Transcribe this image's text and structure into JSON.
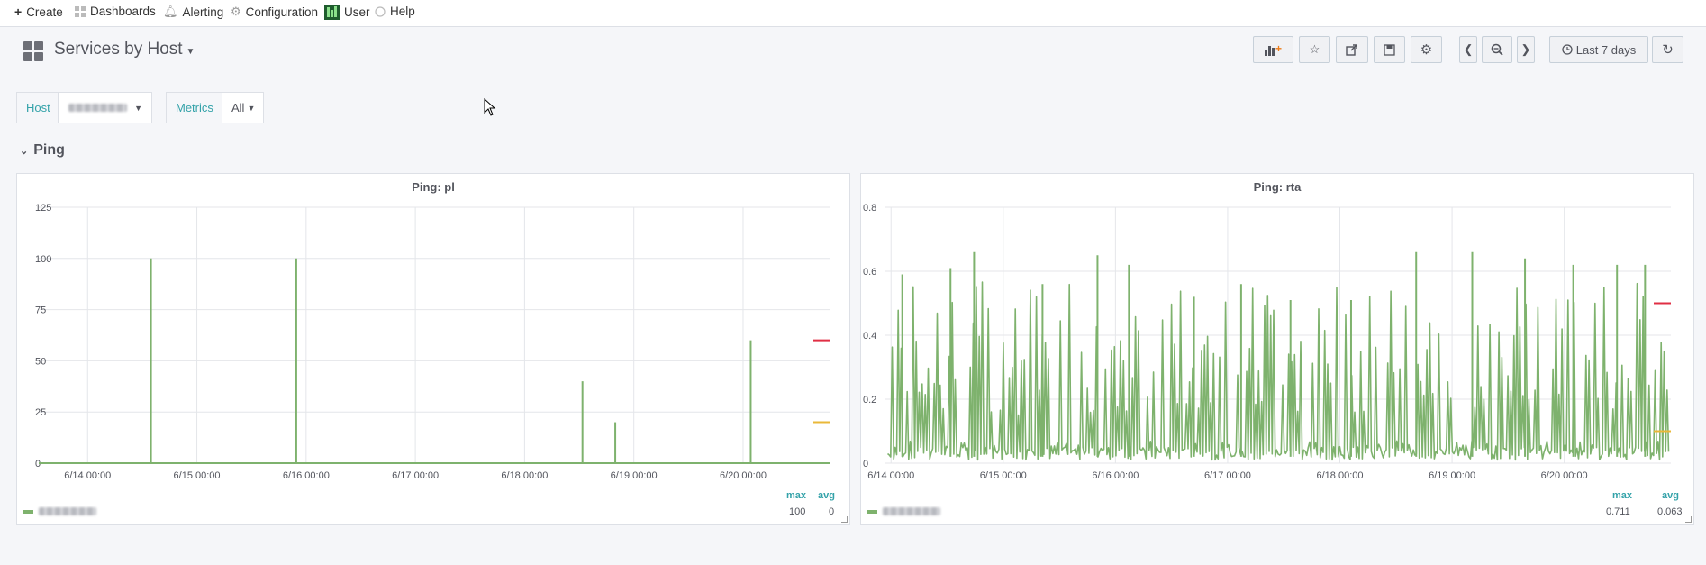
{
  "topnav": {
    "create": "Create",
    "dashboards": "Dashboards",
    "alerting": "Alerting",
    "configuration": "Configuration",
    "user": "User",
    "help": "Help"
  },
  "header": {
    "title": "Services by Host",
    "time_range": "Last 7 days"
  },
  "variables": [
    {
      "label": "Host",
      "value": ""
    },
    {
      "label": "Metrics",
      "value": "All"
    }
  ],
  "row": {
    "title": "Ping"
  },
  "colors": {
    "series": "#7eb26d",
    "threshold_critical": "#e02f44",
    "threshold_warning": "#eab839",
    "accent": "#33a2a9"
  },
  "panels": [
    {
      "title": "Ping: pl",
      "legend_headers": [
        "max",
        "avg"
      ],
      "legend_values": [
        "100",
        "0"
      ]
    },
    {
      "title": "Ping: rta",
      "legend_headers": [
        "max",
        "avg"
      ],
      "legend_values": [
        "0.711",
        "0.063"
      ]
    }
  ],
  "chart_data": [
    {
      "type": "line",
      "title": "Ping: pl",
      "x_ticks": [
        "6/14 00:00",
        "6/15 00:00",
        "6/16 00:00",
        "6/17 00:00",
        "6/18 00:00",
        "6/19 00:00",
        "6/20 00:00"
      ],
      "y_ticks": [
        "0",
        "25",
        "50",
        "75",
        "100",
        "125"
      ],
      "ylim": [
        0,
        125
      ],
      "xlim_days": [
        -0.2,
        6.8
      ],
      "grid": true,
      "series": [
        {
          "values": [
            {
              "x": 0.58,
              "y": 100
            },
            {
              "x": 1.91,
              "y": 100
            },
            {
              "x": 4.53,
              "y": 40
            },
            {
              "x": 4.83,
              "y": 20
            },
            {
              "x": 6.07,
              "y": 60
            }
          ]
        }
      ],
      "thresholds": [
        {
          "y": 60,
          "color": "#e02f44"
        },
        {
          "y": 20,
          "color": "#eab839"
        }
      ]
    },
    {
      "type": "line",
      "title": "Ping: rta",
      "x_ticks": [
        "6/14 00:00",
        "6/15 00:00",
        "6/16 00:00",
        "6/17 00:00",
        "6/18 00:00",
        "6/19 00:00",
        "6/20 00:00"
      ],
      "y_ticks": [
        "0",
        "0.2",
        "0.4",
        "0.6",
        "0.8"
      ],
      "ylim": [
        0,
        0.8
      ],
      "xlim_days": [
        -0.05,
        6.95
      ],
      "grid": true,
      "series": [
        {
          "values": [
            {
              "x": 0.1,
              "y": 0.59
            },
            {
              "x": 0.53,
              "y": 0.61
            },
            {
              "x": 0.74,
              "y": 0.66
            },
            {
              "x": 1.35,
              "y": 0.56
            },
            {
              "x": 1.84,
              "y": 0.65
            },
            {
              "x": 2.12,
              "y": 0.62
            },
            {
              "x": 2.7,
              "y": 0.52
            },
            {
              "x": 3.12,
              "y": 0.56
            },
            {
              "x": 3.56,
              "y": 0.51
            },
            {
              "x": 4.1,
              "y": 0.51
            },
            {
              "x": 4.68,
              "y": 0.66
            },
            {
              "x": 5.18,
              "y": 0.66
            },
            {
              "x": 5.65,
              "y": 0.64
            },
            {
              "x": 6.08,
              "y": 0.62
            },
            {
              "x": 6.47,
              "y": 0.62
            },
            {
              "x": 6.72,
              "y": 0.62
            }
          ]
        }
      ],
      "thresholds": [
        {
          "y": 0.5,
          "color": "#e02f44"
        },
        {
          "y": 0.1,
          "color": "#eab839"
        }
      ]
    }
  ]
}
